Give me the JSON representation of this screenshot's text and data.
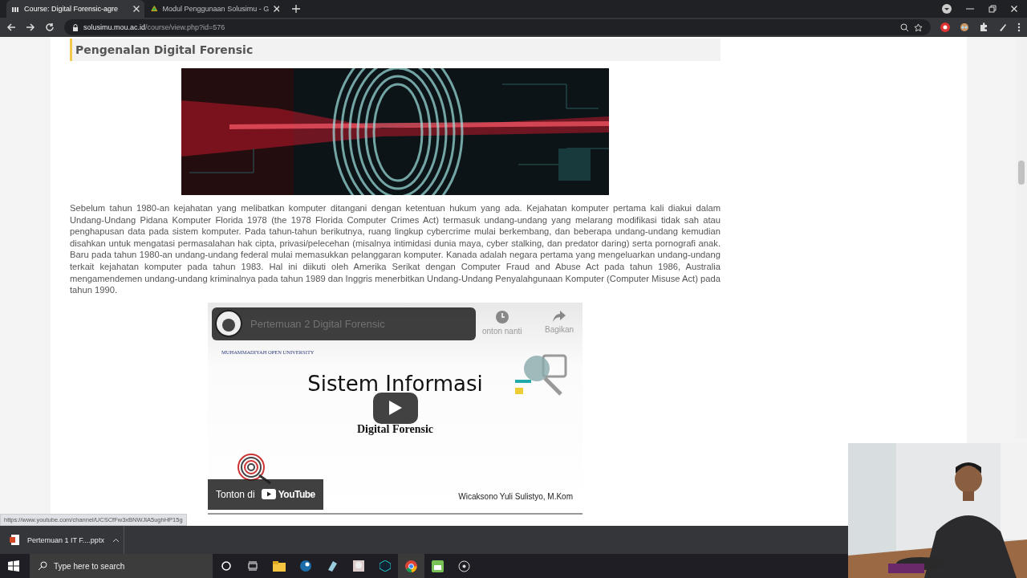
{
  "browser": {
    "tabs": [
      {
        "title": "Course: Digital Forensic-agre",
        "selected": true
      },
      {
        "title": "Modul Penggunaan Solusimu - G",
        "selected": false
      }
    ],
    "address": {
      "host": "solusimu.mou.ac.id",
      "path": "/course/view.php?id=576"
    }
  },
  "page": {
    "section_title": "Pengenalan Digital Forensic",
    "paragraph": "Sebelum tahun 1980-an kejahatan yang melibatkan komputer ditangani dengan ketentuan hukum yang ada. Kejahatan komputer pertama kali diakui dalam Undang-Undang Pidana Komputer Florida 1978 (the 1978 Florida Computer Crimes Act) termasuk undang-undang yang melarang modifikasi tidak sah atau penghapusan data pada sistem komputer. Pada tahun-tahun berikutnya, ruang lingkup cybercrime mulai berkembang, dan beberapa undang-undang kemudian disahkan untuk mengatasi permasalahan hak cipta, privasi/pelecehan (misalnya intimidasi dunia maya, cyber stalking, dan predator daring) serta pornografi anak. Baru pada tahun 1980-an undang-undang federal mulai memasukkan pelanggaran komputer. Kanada adalah negara pertama yang mengeluarkan undang-undang terkait kejahatan komputer pada tahun 1983. Hal ini diikuti oleh Amerika Serikat dengan Computer Fraud and Abuse Act pada tahun 1986, Australia mengamendemen undang-undang kriminalnya pada tahun 1989 dan Inggris menerbitkan Undang-Undang Penyalahgunaan Komputer (Computer Misuse Act) pada tahun 1990.",
    "video": {
      "title": "Pertemuan 2 Digital Forensic",
      "watch_later": "onton nanti",
      "share": "Bagikan",
      "slide": {
        "org": "MUHAMMADIYAH OPEN UNIVERSITY",
        "title": "Sistem Informasi",
        "subtitle": "Digital Forensic",
        "author": "Wicaksono Yuli Sulistyo, M.Kom"
      },
      "watch_on": "Tonton di",
      "youtube": "YouTube"
    }
  },
  "status_url": "https://www.youtube.com/channel/UCSCfFw3xBNWJlA5ughHP15g",
  "downloads": [
    {
      "file": "Pertemuan 1 IT F....pptx"
    }
  ],
  "taskbar": {
    "search_placeholder": "Type here to search"
  }
}
